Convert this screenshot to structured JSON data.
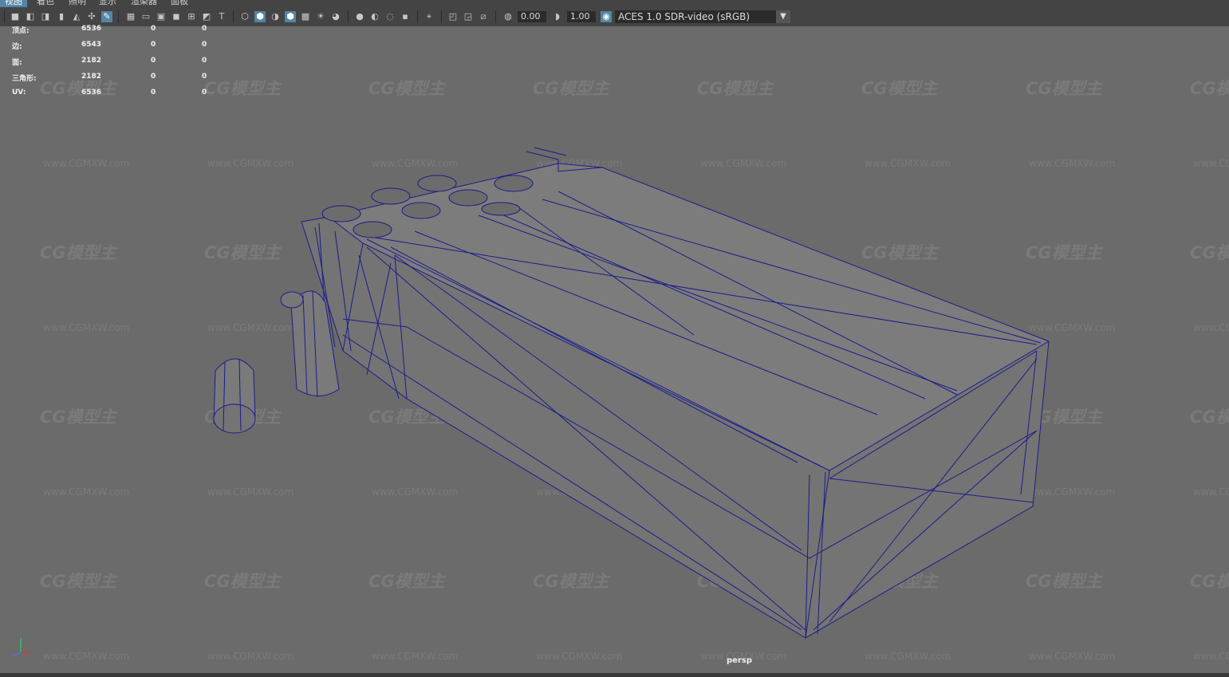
{
  "menu": [
    "视图",
    "着色",
    "照明",
    "显示",
    "渲染器",
    "面板"
  ],
  "toolbar": {
    "exposure_value": "0.00",
    "gamma_value": "1.00",
    "color_space": "ACES 1.0 SDR-video (sRGB)"
  },
  "hud": [
    {
      "label": "顶点:",
      "v1": "6536",
      "v2": "0",
      "v3": "0"
    },
    {
      "label": "边:",
      "v1": "6543",
      "v2": "0",
      "v3": "0"
    },
    {
      "label": "面:",
      "v1": "2182",
      "v2": "0",
      "v3": "0"
    },
    {
      "label": "三角形:",
      "v1": "2182",
      "v2": "0",
      "v3": "0"
    },
    {
      "label": "UV:",
      "v1": "6536",
      "v2": "0",
      "v3": "0"
    }
  ],
  "camera_label": "persp",
  "watermark": {
    "logo": "CG模型主",
    "url": "www.CGMXW.com"
  },
  "colors": {
    "viewport_bg": "#6b6b6b",
    "wireframe": "#1c1c8a",
    "accent": "#5285a6"
  }
}
